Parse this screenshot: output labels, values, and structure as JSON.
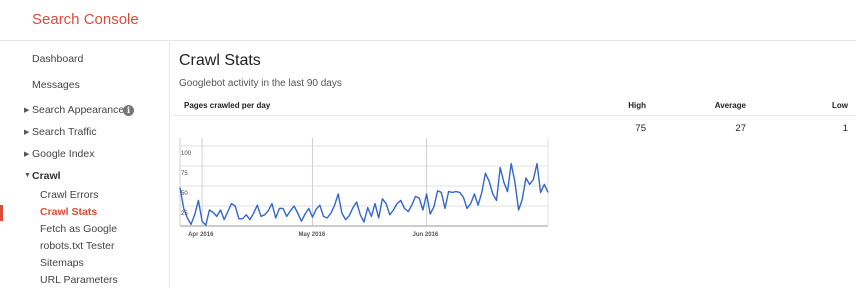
{
  "app": {
    "title": "Search Console"
  },
  "sidebar": {
    "items": [
      {
        "label": "Dashboard",
        "type": "top",
        "arrow": ""
      },
      {
        "label": "Messages",
        "type": "top",
        "arrow": ""
      },
      {
        "label": "Search Appearance",
        "type": "section",
        "arrow": "▶",
        "info": "i"
      },
      {
        "label": "Search Traffic",
        "type": "section",
        "arrow": "▶"
      },
      {
        "label": "Google Index",
        "type": "section",
        "arrow": "▶"
      },
      {
        "label": "Crawl",
        "type": "section",
        "arrow": "▼",
        "bold": true
      },
      {
        "label": "Crawl Errors",
        "type": "sub"
      },
      {
        "label": "Crawl Stats",
        "type": "sub",
        "selected": true
      },
      {
        "label": "Fetch as Google",
        "type": "sub"
      },
      {
        "label": "robots.txt Tester",
        "type": "sub"
      },
      {
        "label": "Sitemaps",
        "type": "sub"
      },
      {
        "label": "URL Parameters",
        "type": "sub"
      }
    ]
  },
  "main": {
    "title": "Crawl Stats",
    "subtitle": "Googlebot activity in the last 90 days",
    "section_label": "Pages crawled per day",
    "columns": {
      "high": "High",
      "average": "Average",
      "low": "Low"
    },
    "values": {
      "high": "75",
      "average": "27",
      "low": "1"
    }
  },
  "colors": {
    "brand": "#dd4b39",
    "line": "#3366cc"
  },
  "chart_data": {
    "type": "line",
    "y_ticks": [
      25,
      50,
      75,
      100
    ],
    "ylim": [
      0,
      110
    ],
    "x_tick_labels": [
      {
        "label": "Apr 2016",
        "index": 6
      },
      {
        "label": "May 2016",
        "index": 36
      },
      {
        "label": "Jun 2016",
        "index": 67
      }
    ],
    "series": [
      {
        "values": [
          48,
          22,
          10,
          2,
          14,
          32,
          6,
          1,
          20,
          17,
          12,
          20,
          8,
          18,
          28,
          25,
          9,
          9,
          14,
          8,
          16,
          26,
          12,
          14,
          19,
          28,
          10,
          22,
          22,
          12,
          19,
          25,
          16,
          6,
          15,
          22,
          11,
          21,
          26,
          12,
          10,
          16,
          26,
          40,
          16,
          8,
          13,
          23,
          30,
          14,
          5,
          23,
          12,
          28,
          10,
          34,
          28,
          14,
          20,
          28,
          32,
          22,
          18,
          26,
          37,
          35,
          20,
          40,
          15,
          24,
          44,
          42,
          22,
          43,
          42,
          43,
          42,
          36,
          22,
          28,
          40,
          26,
          42,
          66,
          56,
          40,
          32,
          73,
          55,
          43,
          78,
          55,
          20,
          33,
          60,
          52,
          58,
          78,
          42,
          52,
          42
        ]
      }
    ]
  }
}
